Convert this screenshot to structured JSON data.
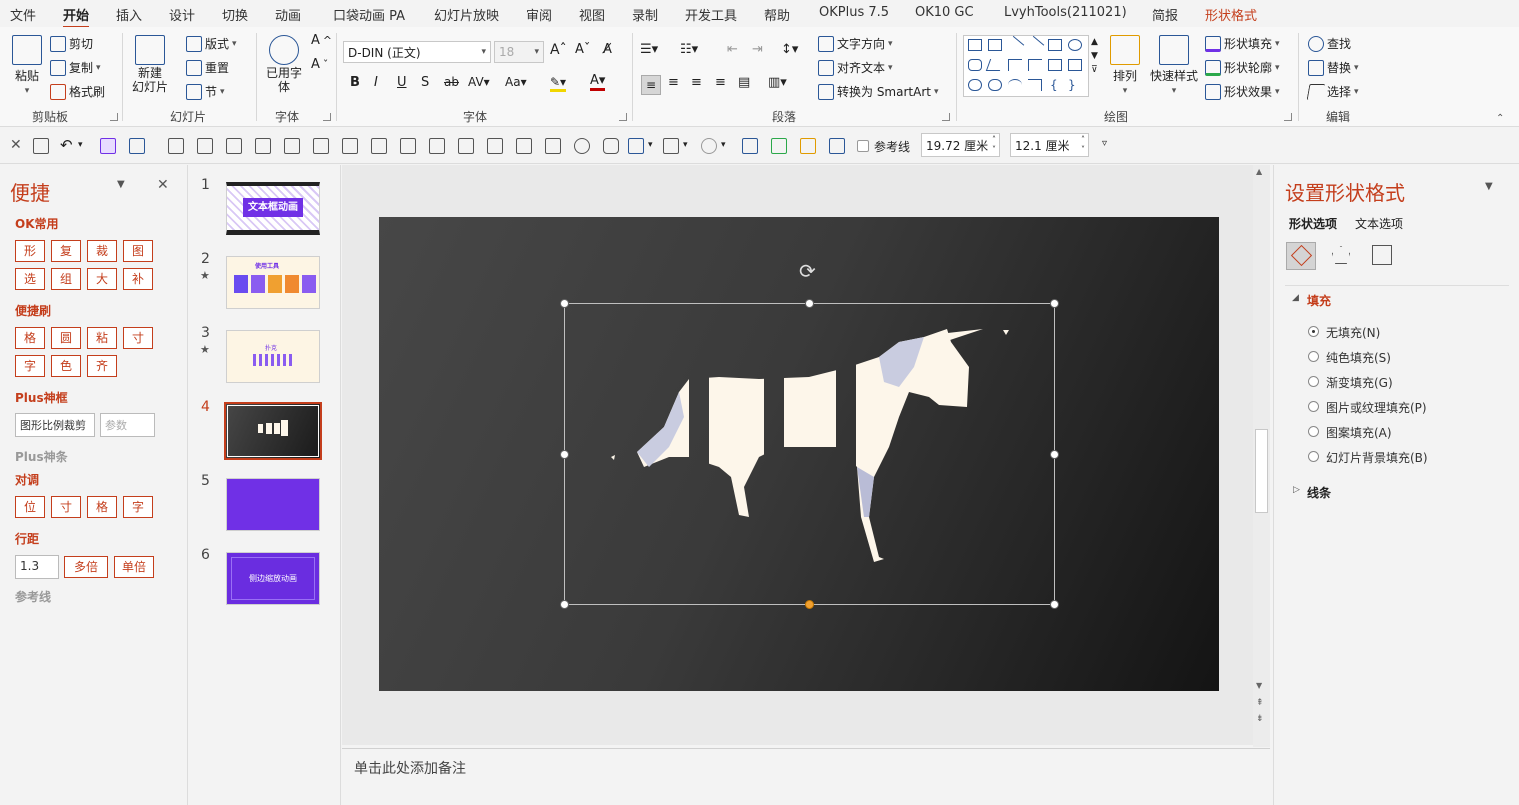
{
  "menu": {
    "tabs": [
      "文件",
      "开始",
      "插入",
      "设计",
      "切换",
      "动画",
      "口袋动画 PA",
      "幻灯片放映",
      "审阅",
      "视图",
      "录制",
      "开发工具",
      "帮助",
      "OKPlus 7.5",
      "OK10 GC",
      "LvyhTools(211021)",
      "简报",
      "形状格式"
    ],
    "active": "开始",
    "contextual": "形状格式"
  },
  "ribbon": {
    "clipboard": {
      "paste": "粘贴",
      "cut": "剪切",
      "copy": "复制",
      "format_painter": "格式刷",
      "label": "剪贴板"
    },
    "slides": {
      "new_slide": "新建\n幻灯片",
      "layout": "版式",
      "reset": "重置",
      "section": "节",
      "label": "幻灯片"
    },
    "used_fonts": {
      "btn": "已用字\n体",
      "label": "字体"
    },
    "font": {
      "name": "D-DIN (正文)",
      "size": "18",
      "label": "字体"
    },
    "paragraph": {
      "text_direction": "文字方向",
      "align_text": "对齐文本",
      "convert_smartart": "转换为 SmartArt",
      "label": "段落"
    },
    "drawing": {
      "arrange": "排列",
      "quick_styles": "快速样式",
      "shape_fill": "形状填充",
      "shape_outline": "形状轮廓",
      "shape_effects": "形状效果",
      "label": "绘图"
    },
    "editing": {
      "find": "查找",
      "replace": "替换",
      "select": "选择",
      "label": "编辑"
    }
  },
  "quickbar": {
    "guides_label": "参考线",
    "width": "19.72 厘米",
    "height": "12.1 厘米"
  },
  "left_pane": {
    "title": "便捷",
    "ok_common": {
      "title": "OK常用",
      "buttons": [
        "形",
        "复",
        "裁",
        "图",
        "选",
        "组",
        "大",
        "补"
      ]
    },
    "brush": {
      "title": "便捷刷",
      "buttons": [
        "格",
        "圆",
        "粘",
        "寸",
        "字",
        "色",
        "齐"
      ]
    },
    "plus_frame": {
      "title": "Plus神框",
      "input": "图形比例裁剪",
      "placeholder": "参数"
    },
    "plus_bar": {
      "title": "Plus神条"
    },
    "align": {
      "title": "对调",
      "buttons": [
        "位",
        "寸",
        "格",
        "字"
      ]
    },
    "line_spacing": {
      "title": "行距",
      "value": "1.3",
      "multi": "多倍",
      "single": "单倍"
    },
    "guides": {
      "title": "参考线"
    }
  },
  "thumbnails": [
    {
      "num": "1",
      "star": "",
      "text": "文本框动画"
    },
    {
      "num": "2",
      "star": "★",
      "text": "使用工具"
    },
    {
      "num": "3",
      "star": "★",
      "text": "扑克"
    },
    {
      "num": "4",
      "star": "",
      "text": ""
    },
    {
      "num": "5",
      "star": "",
      "text": ""
    },
    {
      "num": "6",
      "star": "",
      "text": "侧边缩放动画"
    }
  ],
  "active_slide": 4,
  "notes_placeholder": "单击此处添加备注",
  "right_pane": {
    "title": "设置形状格式",
    "tabs": [
      "形状选项",
      "文本选项"
    ],
    "fill_section": "填充",
    "fill_options": [
      "无填充(N)",
      "纯色填充(S)",
      "渐变填充(G)",
      "图片或纹理填充(P)",
      "图案填充(A)",
      "幻灯片背景填充(B)"
    ],
    "selected_fill": 0,
    "line_section": "线条"
  },
  "colors": {
    "accent": "#c43e1c",
    "purple": "#7030e6",
    "slide_dark": "#2b2b2b",
    "unicorn": "#fdf6ea"
  }
}
